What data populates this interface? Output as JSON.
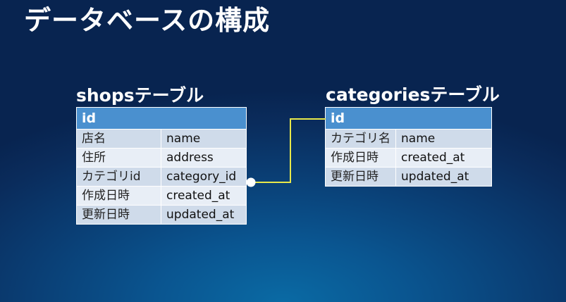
{
  "title": "データベースの構成",
  "shops_table": {
    "caption": "shopsテーブル",
    "pk": "id",
    "rows": [
      {
        "label": "店名",
        "column": "name"
      },
      {
        "label": "住所",
        "column": "address"
      },
      {
        "label": "カテゴリid",
        "column": "category_id"
      },
      {
        "label": "作成日時",
        "column": "created_at"
      },
      {
        "label": "更新日時",
        "column": "updated_at"
      }
    ]
  },
  "categories_table": {
    "caption": "categoriesテーブル",
    "pk": "id",
    "rows": [
      {
        "label": "カテゴリ名",
        "column": "name"
      },
      {
        "label": "作成日時",
        "column": "created_at"
      },
      {
        "label": "更新日時",
        "column": "updated_at"
      }
    ]
  },
  "relation": {
    "from": "shops.category_id",
    "to": "categories.id",
    "color": "#e8e84a"
  },
  "colors": {
    "header": "#4a90cf",
    "row_odd": "#cfdbea",
    "row_even": "#e8eef6"
  }
}
